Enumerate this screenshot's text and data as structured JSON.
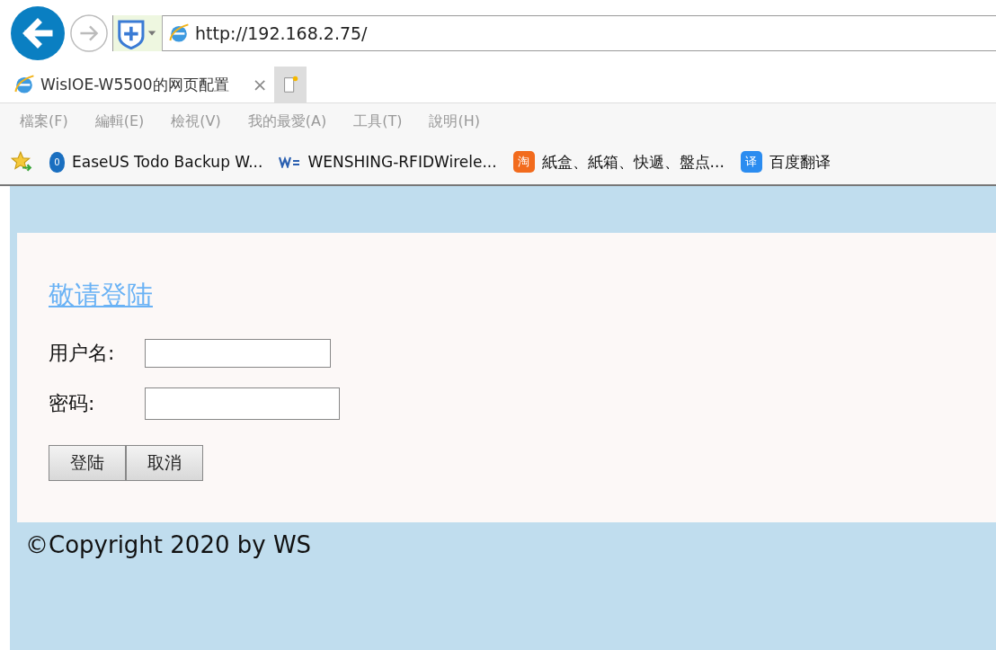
{
  "browser": {
    "address": "http://192.168.2.75/",
    "tabs": [
      {
        "label": "WisIOE-W5500的网页配置",
        "selected": true,
        "close": "×"
      }
    ],
    "menu": [
      "檔案(F)",
      "編輯(E)",
      "檢視(V)",
      "我的最愛(A)",
      "工具(T)",
      "說明(H)"
    ],
    "bookmarks": [
      {
        "kind": "drop",
        "badge": "0",
        "label": "EaseUS Todo Backup W..."
      },
      {
        "kind": "ws",
        "label": "WENSHING-RFIDWirele..."
      },
      {
        "kind": "tao",
        "badge": "淘",
        "label": "紙盒、紙箱、快遞、盤点..."
      },
      {
        "kind": "translate",
        "badge": "译",
        "label": "百度翻译"
      }
    ]
  },
  "page": {
    "heading": "敬请登陆",
    "fields": [
      {
        "label": "用户名:",
        "kind": "text"
      },
      {
        "label": "密码:",
        "kind": "password"
      }
    ],
    "buttons": [
      "登陆",
      "取消"
    ],
    "footer": "©Copyright 2020 by WS"
  }
}
